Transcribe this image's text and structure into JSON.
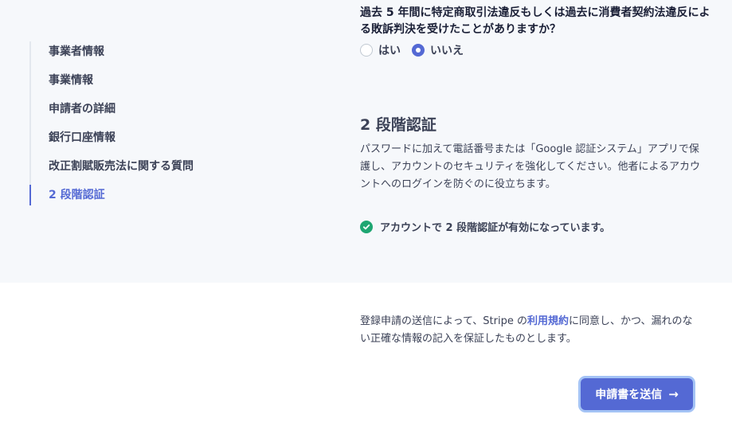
{
  "sidebar": {
    "items": [
      {
        "label": "事業者情報"
      },
      {
        "label": "事業情報"
      },
      {
        "label": "申請者の詳細"
      },
      {
        "label": "銀行口座情報"
      },
      {
        "label": "改正割賦販売法に関する質問"
      },
      {
        "label": "2 段階認証"
      }
    ]
  },
  "question": {
    "text": "過去 5 年間に特定商取引法違反もしくは過去に消費者契約法違反による敗訴判決を受けたことがありますか？",
    "options": [
      {
        "label": "はい",
        "checked": false
      },
      {
        "label": "いいえ",
        "checked": true
      }
    ]
  },
  "two_factor": {
    "title": "2 段階認証",
    "description": "パスワードに加えて電話番号または「Google 認証システム」アプリで保護し、アカウントのセキュリティを強化してください。他者によるアカウントへのログインを防ぐのに役立ちます。",
    "status": "アカウントで 2 段階認証が有効になっています。",
    "status_icon": "check-circle-icon",
    "status_color": "#1ea672"
  },
  "terms": {
    "before": "登録申請の送信によって、Stripe の",
    "link": "利用規約",
    "after": "に同意し、かつ、漏れのない正確な情報の記入を保証したものとします。"
  },
  "submit": {
    "label": "申請書を送信",
    "arrow": "→"
  },
  "colors": {
    "accent": "#5469d4",
    "panel_bg": "#f6f8fb",
    "success": "#1ea672"
  }
}
